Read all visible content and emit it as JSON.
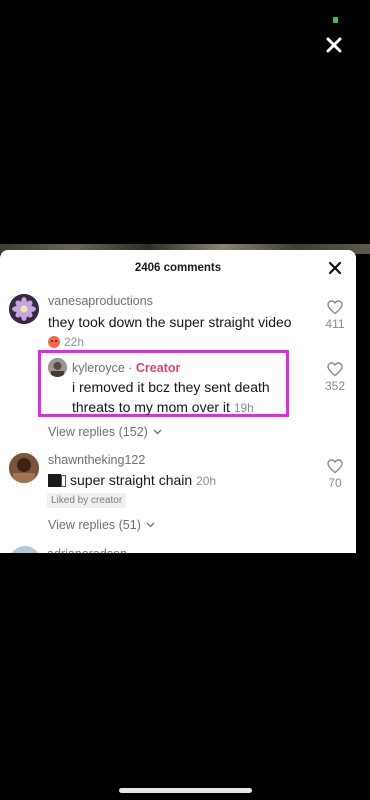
{
  "sheet": {
    "comment_count": "2406 comments"
  },
  "comments": [
    {
      "username": "vanesaproductions",
      "text": "they took down the super straight video",
      "time": "22h",
      "likes": "411",
      "view_replies": "View replies (152)"
    },
    {
      "username": "kyleroyce",
      "separator": " · ",
      "badge": "Creator",
      "text": "i removed it bcz they sent death threats to my mom over it",
      "time": "19h",
      "likes": "352"
    },
    {
      "username": "shawntheking122",
      "text": "super straight chain",
      "time": "20h",
      "liked_badge": "Liked by creator",
      "likes": "70",
      "view_replies": "View replies (51)"
    },
    {
      "username": "adrianeradson"
    }
  ],
  "colors": {
    "highlight": "#e02be6",
    "creator": "#d04a6e",
    "status_dot": "#36c45a"
  }
}
